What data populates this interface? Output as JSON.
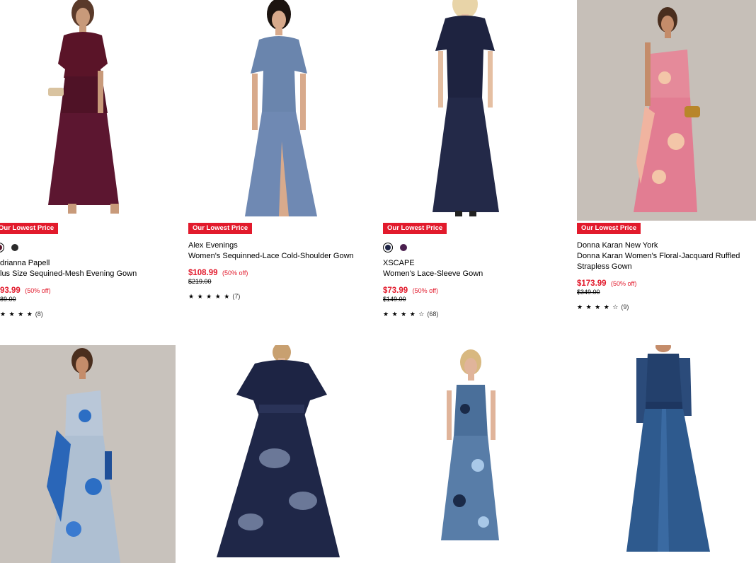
{
  "badge_text": "Our Lowest Price",
  "products": [
    {
      "brand": "drianna Papell",
      "name": "lus Size Sequined-Mesh Evening Gown",
      "price": "93.99",
      "discount": "(50% off)",
      "original_price": "89.00",
      "stars": "★ ★ ★ ★",
      "review_count": "(8)",
      "swatches": [
        "#5a1428",
        "#2b2b2b"
      ]
    },
    {
      "brand": "Alex Evenings",
      "name": "Women's Sequinned-Lace Cold-Shoulder Gown",
      "price": "$108.99",
      "discount": "(50% off)",
      "original_price": "$219.00",
      "stars": "★ ★ ★ ★ ★",
      "review_count": "(7)"
    },
    {
      "brand": "XSCAPE",
      "name": "Women's Lace-Sleeve Gown",
      "price": "$73.99",
      "discount": "(50% off)",
      "original_price": "$149.00",
      "stars": "★ ★ ★ ★ ☆",
      "review_count": "(68)",
      "swatches": [
        "#1f2547",
        "#4a1f4e"
      ]
    },
    {
      "brand": "Donna Karan New York",
      "name": "Donna Karan Women's Floral-Jacquard Ruffled Strapless Gown",
      "price": "$173.99",
      "discount": "(50% off)",
      "original_price": "$349.00",
      "stars": "★ ★ ★ ★ ☆",
      "review_count": "(9)"
    }
  ],
  "colors": {
    "accent": "#e21a2c"
  }
}
